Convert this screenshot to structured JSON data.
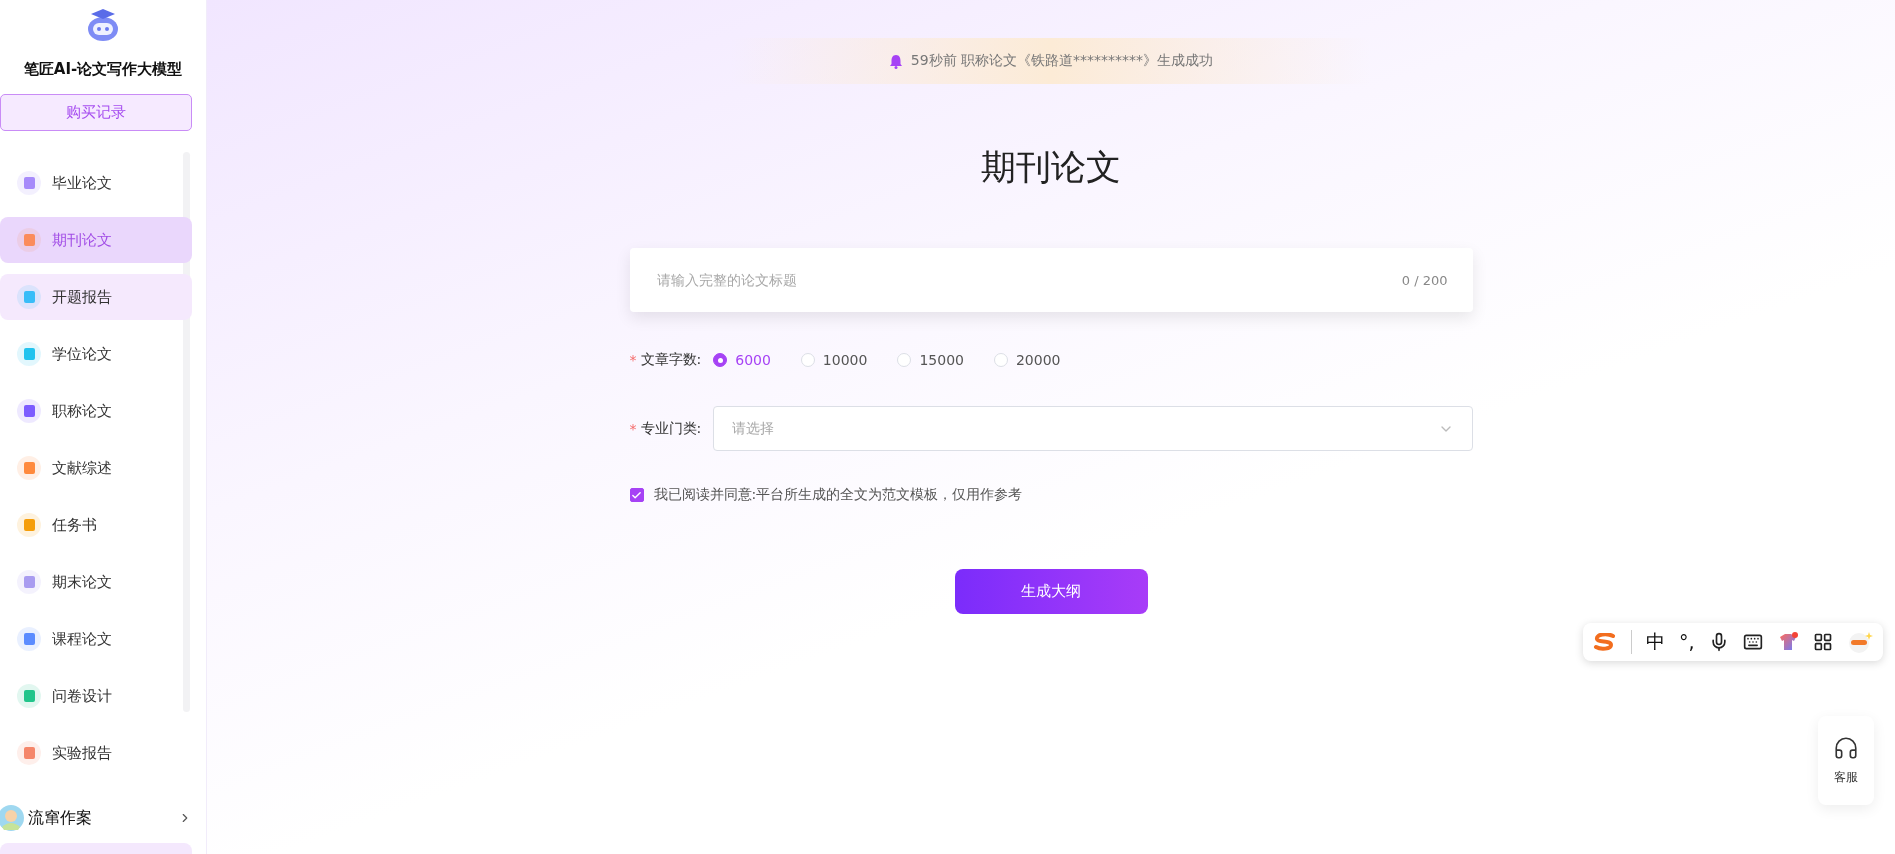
{
  "brand": {
    "title": "笔匠AI-论文写作大模型"
  },
  "purchase_button": "购买记录",
  "nav_items": [
    {
      "label": "毕业论文",
      "selected": false,
      "hovered": false,
      "color": "#a78bfa"
    },
    {
      "label": "期刊论文",
      "selected": true,
      "hovered": false,
      "color": "#fb8c5a"
    },
    {
      "label": "开题报告",
      "selected": false,
      "hovered": true,
      "color": "#38bdf8"
    },
    {
      "label": "学位论文",
      "selected": false,
      "hovered": false,
      "color": "#22c3ee"
    },
    {
      "label": "职称论文",
      "selected": false,
      "hovered": false,
      "color": "#7c5cff"
    },
    {
      "label": "文献综述",
      "selected": false,
      "hovered": false,
      "color": "#ff8a3d"
    },
    {
      "label": "任务书",
      "selected": false,
      "hovered": false,
      "color": "#f59e0b"
    },
    {
      "label": "期末论文",
      "selected": false,
      "hovered": false,
      "color": "#a99cf0"
    },
    {
      "label": "课程论文",
      "selected": false,
      "hovered": false,
      "color": "#5b8cff"
    },
    {
      "label": "问卷设计",
      "selected": false,
      "hovered": false,
      "color": "#22c58b"
    },
    {
      "label": "实验报告",
      "selected": false,
      "hovered": false,
      "color": "#f5866a"
    }
  ],
  "user": {
    "name": "流窜作案"
  },
  "notification": {
    "text": "59秒前 职称论文《铁路道**********》生成成功"
  },
  "page_title": "期刊论文",
  "title_field": {
    "placeholder": "请输入完整的论文标题",
    "counter": "0 / 200"
  },
  "word_count": {
    "required_mark": "*",
    "label": "文章字数:",
    "options": [
      {
        "label": "6000",
        "selected": true
      },
      {
        "label": "10000",
        "selected": false
      },
      {
        "label": "15000",
        "selected": false
      },
      {
        "label": "20000",
        "selected": false
      }
    ]
  },
  "major": {
    "required_mark": "*",
    "label": "专业门类:",
    "placeholder": "请选择"
  },
  "agreement": {
    "text": "我已阅读并同意:平台所生成的全文为范文模板，仅用作参考",
    "checked": true
  },
  "submit_button": "生成大纲",
  "ime_toolbar": {
    "mode": "中",
    "punctuation": "°,"
  },
  "service": {
    "label": "客服"
  }
}
